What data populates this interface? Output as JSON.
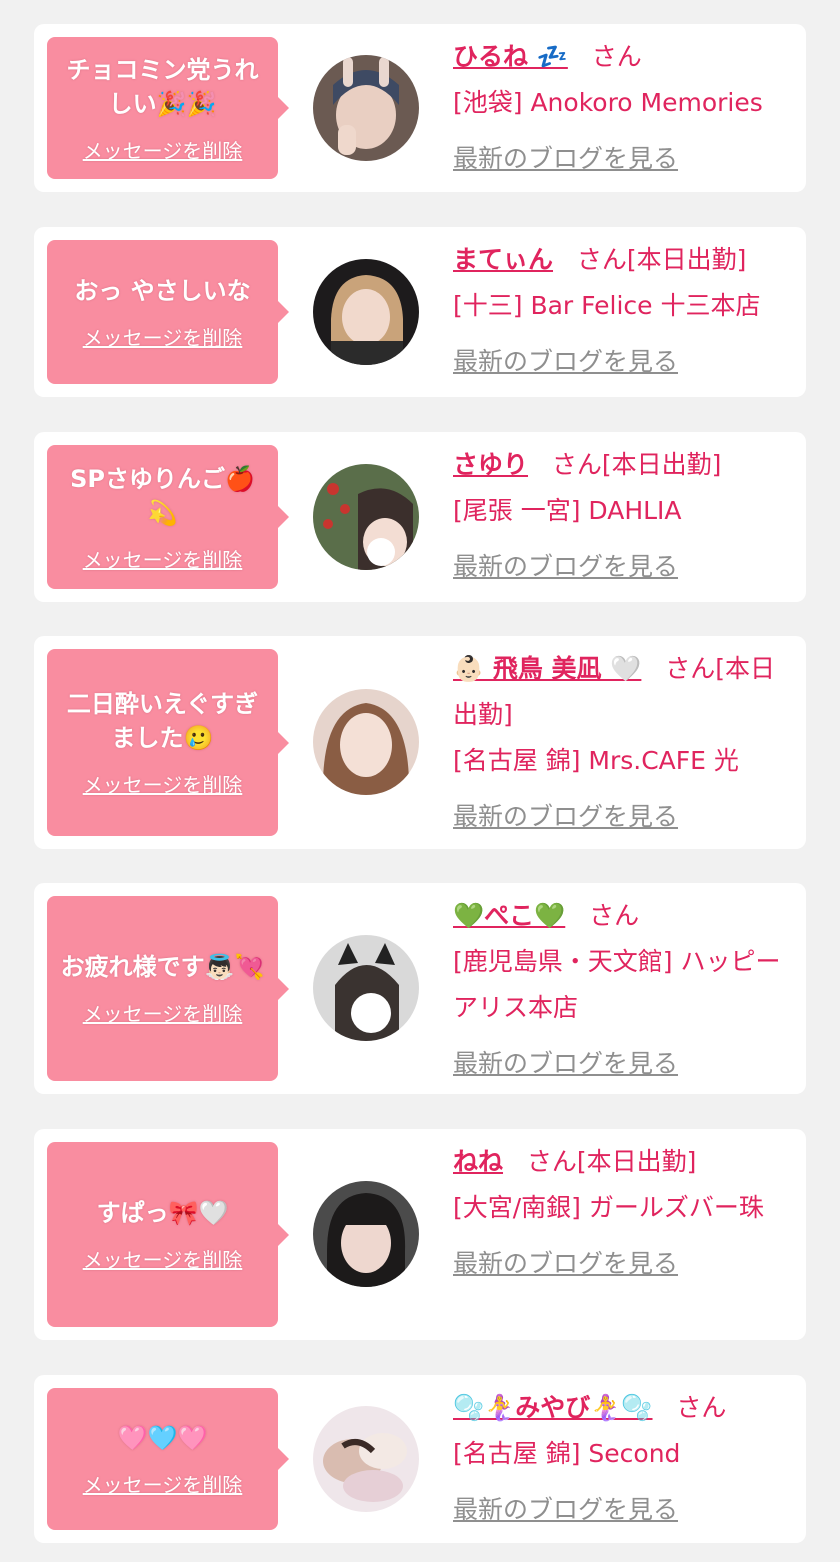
{
  "ui": {
    "delete_label": "メッセージを削除",
    "blog_label": "最新のブログを見る",
    "san_suffix": "さん",
    "accent_color": "#e0245e",
    "bubble_color": "#f98da0",
    "link_gray": "#8f8f8f"
  },
  "cards": [
    {
      "message": "チョコミン党うれしい🎉🎉",
      "name": "ひるね 💤",
      "status": "さん",
      "shop": "[池袋] Anokoro Memories"
    },
    {
      "message": "おっ やさしいな",
      "name": "まてぃん",
      "status": "さん[本日出勤]",
      "shop": "[十三] Bar Felice 十三本店"
    },
    {
      "message": "SPさゆりんご🍎💫",
      "name": "さゆり",
      "status": "さん[本日出勤]",
      "shop": "[尾張 一宮] DAHLIA"
    },
    {
      "message": "二日酔いえぐすぎました🥲",
      "name": "👶🏻 飛鳥 美凪 🤍",
      "status": "さん[本日出勤]",
      "shop": "[名古屋 錦] Mrs.CAFE 光"
    },
    {
      "message": "お疲れ様です👼🏻💘",
      "name": "💚ぺこ💚",
      "status": "さん",
      "shop": "[鹿児島県・天文館] ハッピーアリス本店"
    },
    {
      "message": "すぱっ🎀🤍",
      "name": "ねね",
      "status": "さん[本日出勤]",
      "shop": "[大宮/南銀] ガールズバー珠"
    },
    {
      "message": "🩷🩵🩷",
      "name": "🫧🧜‍♀️みやび🧜‍♀️🫧",
      "status": "さん",
      "shop": "[名古屋 錦] Second"
    }
  ]
}
